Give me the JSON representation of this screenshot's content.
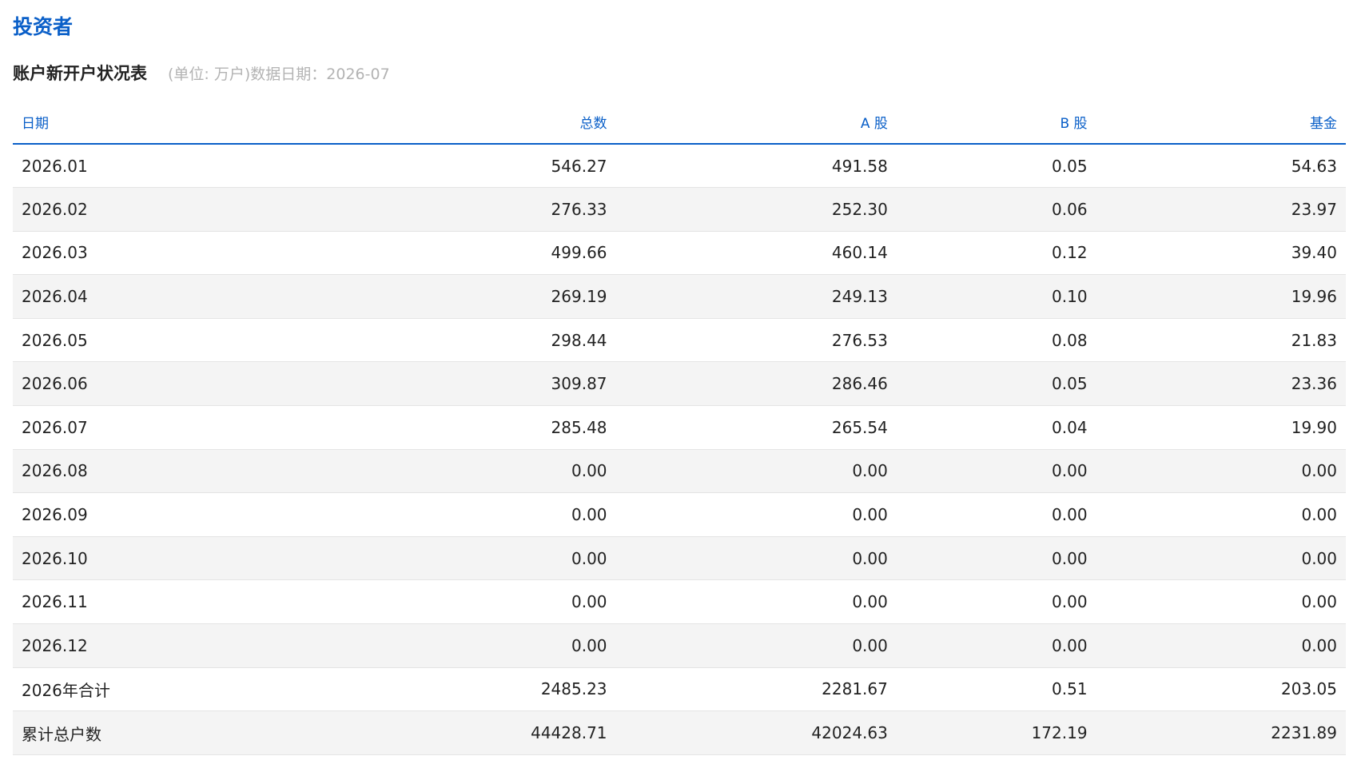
{
  "section": {
    "title": "投资者"
  },
  "table": {
    "name": "账户新开户状况表",
    "meta": "(单位: 万户)数据日期：2026-07",
    "columns": [
      "日期",
      "总数",
      "A 股",
      "B 股",
      "基金"
    ],
    "rows": [
      [
        "2026.01",
        "546.27",
        "491.58",
        "0.05",
        "54.63"
      ],
      [
        "2026.02",
        "276.33",
        "252.30",
        "0.06",
        "23.97"
      ],
      [
        "2026.03",
        "499.66",
        "460.14",
        "0.12",
        "39.40"
      ],
      [
        "2026.04",
        "269.19",
        "249.13",
        "0.10",
        "19.96"
      ],
      [
        "2026.05",
        "298.44",
        "276.53",
        "0.08",
        "21.83"
      ],
      [
        "2026.06",
        "309.87",
        "286.46",
        "0.05",
        "23.36"
      ],
      [
        "2026.07",
        "285.48",
        "265.54",
        "0.04",
        "19.90"
      ],
      [
        "2026.08",
        "0.00",
        "0.00",
        "0.00",
        "0.00"
      ],
      [
        "2026.09",
        "0.00",
        "0.00",
        "0.00",
        "0.00"
      ],
      [
        "2026.10",
        "0.00",
        "0.00",
        "0.00",
        "0.00"
      ],
      [
        "2026.11",
        "0.00",
        "0.00",
        "0.00",
        "0.00"
      ],
      [
        "2026.12",
        "0.00",
        "0.00",
        "0.00",
        "0.00"
      ],
      [
        "2026年合计",
        "2485.23",
        "2281.67",
        "0.51",
        "203.05"
      ],
      [
        "累计总户数",
        "44428.71",
        "42024.63",
        "172.19",
        "2231.89"
      ]
    ]
  },
  "colors": {
    "accent": "#0a5fc8",
    "text": "#222222",
    "muted": "#b3b3b3",
    "stripe": "#f4f4f4"
  }
}
